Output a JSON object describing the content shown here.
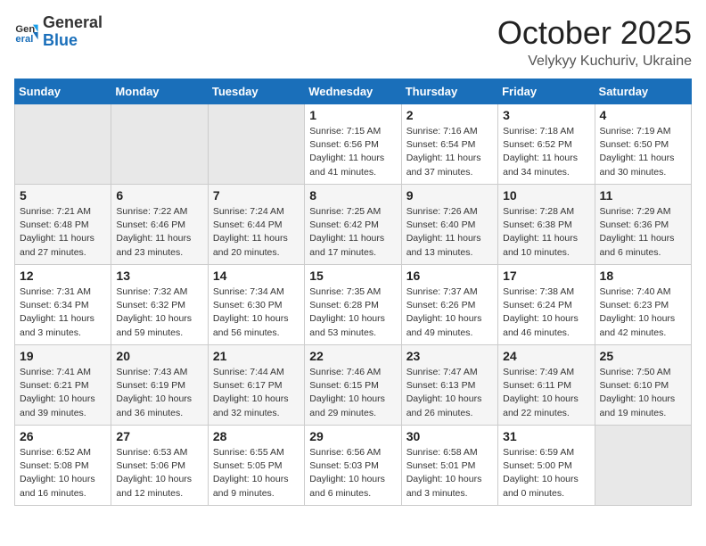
{
  "header": {
    "logo_general": "General",
    "logo_blue": "Blue",
    "month_year": "October 2025",
    "location": "Velykyy Kuchuriv, Ukraine"
  },
  "weekdays": [
    "Sunday",
    "Monday",
    "Tuesday",
    "Wednesday",
    "Thursday",
    "Friday",
    "Saturday"
  ],
  "weeks": [
    [
      {
        "day": "",
        "info": ""
      },
      {
        "day": "",
        "info": ""
      },
      {
        "day": "",
        "info": ""
      },
      {
        "day": "1",
        "info": "Sunrise: 7:15 AM\nSunset: 6:56 PM\nDaylight: 11 hours\nand 41 minutes."
      },
      {
        "day": "2",
        "info": "Sunrise: 7:16 AM\nSunset: 6:54 PM\nDaylight: 11 hours\nand 37 minutes."
      },
      {
        "day": "3",
        "info": "Sunrise: 7:18 AM\nSunset: 6:52 PM\nDaylight: 11 hours\nand 34 minutes."
      },
      {
        "day": "4",
        "info": "Sunrise: 7:19 AM\nSunset: 6:50 PM\nDaylight: 11 hours\nand 30 minutes."
      }
    ],
    [
      {
        "day": "5",
        "info": "Sunrise: 7:21 AM\nSunset: 6:48 PM\nDaylight: 11 hours\nand 27 minutes."
      },
      {
        "day": "6",
        "info": "Sunrise: 7:22 AM\nSunset: 6:46 PM\nDaylight: 11 hours\nand 23 minutes."
      },
      {
        "day": "7",
        "info": "Sunrise: 7:24 AM\nSunset: 6:44 PM\nDaylight: 11 hours\nand 20 minutes."
      },
      {
        "day": "8",
        "info": "Sunrise: 7:25 AM\nSunset: 6:42 PM\nDaylight: 11 hours\nand 17 minutes."
      },
      {
        "day": "9",
        "info": "Sunrise: 7:26 AM\nSunset: 6:40 PM\nDaylight: 11 hours\nand 13 minutes."
      },
      {
        "day": "10",
        "info": "Sunrise: 7:28 AM\nSunset: 6:38 PM\nDaylight: 11 hours\nand 10 minutes."
      },
      {
        "day": "11",
        "info": "Sunrise: 7:29 AM\nSunset: 6:36 PM\nDaylight: 11 hours\nand 6 minutes."
      }
    ],
    [
      {
        "day": "12",
        "info": "Sunrise: 7:31 AM\nSunset: 6:34 PM\nDaylight: 11 hours\nand 3 minutes."
      },
      {
        "day": "13",
        "info": "Sunrise: 7:32 AM\nSunset: 6:32 PM\nDaylight: 10 hours\nand 59 minutes."
      },
      {
        "day": "14",
        "info": "Sunrise: 7:34 AM\nSunset: 6:30 PM\nDaylight: 10 hours\nand 56 minutes."
      },
      {
        "day": "15",
        "info": "Sunrise: 7:35 AM\nSunset: 6:28 PM\nDaylight: 10 hours\nand 53 minutes."
      },
      {
        "day": "16",
        "info": "Sunrise: 7:37 AM\nSunset: 6:26 PM\nDaylight: 10 hours\nand 49 minutes."
      },
      {
        "day": "17",
        "info": "Sunrise: 7:38 AM\nSunset: 6:24 PM\nDaylight: 10 hours\nand 46 minutes."
      },
      {
        "day": "18",
        "info": "Sunrise: 7:40 AM\nSunset: 6:23 PM\nDaylight: 10 hours\nand 42 minutes."
      }
    ],
    [
      {
        "day": "19",
        "info": "Sunrise: 7:41 AM\nSunset: 6:21 PM\nDaylight: 10 hours\nand 39 minutes."
      },
      {
        "day": "20",
        "info": "Sunrise: 7:43 AM\nSunset: 6:19 PM\nDaylight: 10 hours\nand 36 minutes."
      },
      {
        "day": "21",
        "info": "Sunrise: 7:44 AM\nSunset: 6:17 PM\nDaylight: 10 hours\nand 32 minutes."
      },
      {
        "day": "22",
        "info": "Sunrise: 7:46 AM\nSunset: 6:15 PM\nDaylight: 10 hours\nand 29 minutes."
      },
      {
        "day": "23",
        "info": "Sunrise: 7:47 AM\nSunset: 6:13 PM\nDaylight: 10 hours\nand 26 minutes."
      },
      {
        "day": "24",
        "info": "Sunrise: 7:49 AM\nSunset: 6:11 PM\nDaylight: 10 hours\nand 22 minutes."
      },
      {
        "day": "25",
        "info": "Sunrise: 7:50 AM\nSunset: 6:10 PM\nDaylight: 10 hours\nand 19 minutes."
      }
    ],
    [
      {
        "day": "26",
        "info": "Sunrise: 6:52 AM\nSunset: 5:08 PM\nDaylight: 10 hours\nand 16 minutes."
      },
      {
        "day": "27",
        "info": "Sunrise: 6:53 AM\nSunset: 5:06 PM\nDaylight: 10 hours\nand 12 minutes."
      },
      {
        "day": "28",
        "info": "Sunrise: 6:55 AM\nSunset: 5:05 PM\nDaylight: 10 hours\nand 9 minutes."
      },
      {
        "day": "29",
        "info": "Sunrise: 6:56 AM\nSunset: 5:03 PM\nDaylight: 10 hours\nand 6 minutes."
      },
      {
        "day": "30",
        "info": "Sunrise: 6:58 AM\nSunset: 5:01 PM\nDaylight: 10 hours\nand 3 minutes."
      },
      {
        "day": "31",
        "info": "Sunrise: 6:59 AM\nSunset: 5:00 PM\nDaylight: 10 hours\nand 0 minutes."
      },
      {
        "day": "",
        "info": ""
      }
    ]
  ]
}
